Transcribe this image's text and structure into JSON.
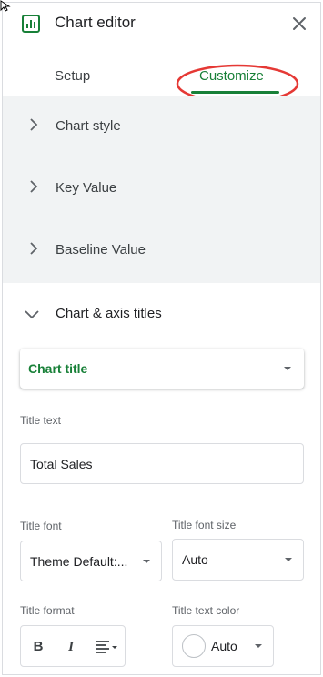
{
  "header": {
    "title": "Chart editor",
    "logo_icon": "chart-logo-icon",
    "close_icon": "close-icon"
  },
  "tabs": [
    {
      "label": "Setup",
      "active": false
    },
    {
      "label": "Customize",
      "active": true
    }
  ],
  "sections_collapsed": [
    {
      "label": "Chart style"
    },
    {
      "label": "Key Value"
    },
    {
      "label": "Baseline Value"
    }
  ],
  "section_open": {
    "label": "Chart & axis titles"
  },
  "title_selector": {
    "value": "Chart title"
  },
  "title_text": {
    "label": "Title text",
    "value": "Total Sales"
  },
  "title_font": {
    "label": "Title font",
    "value": "Theme Default:..."
  },
  "title_font_size": {
    "label": "Title font size",
    "value": "Auto"
  },
  "title_format": {
    "label": "Title format",
    "bold": "B",
    "italic": "I",
    "align_icon": "align-left-icon"
  },
  "title_text_color": {
    "label": "Title text color",
    "value": "Auto"
  },
  "colors": {
    "accent": "#188038",
    "highlight": "#e53935",
    "section_bg": "#f1f3f4"
  }
}
